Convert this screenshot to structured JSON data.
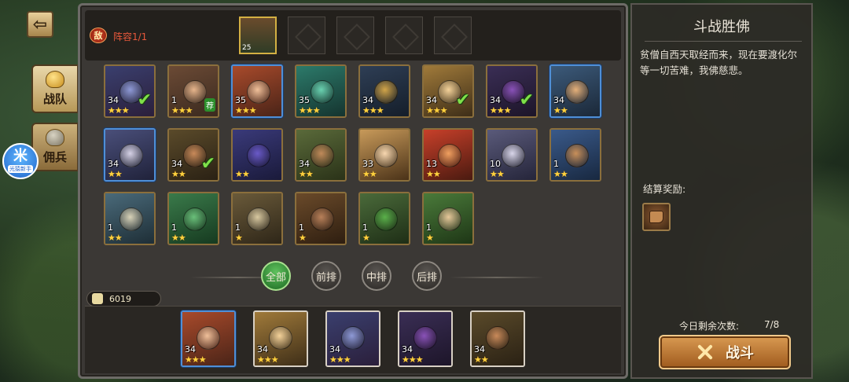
{
  "nav": {
    "back_icon": "back-arrow-icon"
  },
  "side_tabs": [
    {
      "label": "战队",
      "icon": "team-helmet-icon",
      "active": true
    },
    {
      "label": "佣兵",
      "icon": "mercenary-helmet-icon",
      "active": false
    }
  ],
  "beginner_badge": {
    "glyph": "米",
    "caption": "光猿新手"
  },
  "lineup": {
    "enemy_glyph": "敌",
    "label": "阵容1/1",
    "slots": [
      {
        "filled": true,
        "level": "25"
      },
      {
        "filled": false
      },
      {
        "filled": false
      },
      {
        "filled": false
      },
      {
        "filled": false
      }
    ]
  },
  "heroes": [
    {
      "level": "34",
      "stars": "★★★",
      "checked": true,
      "frame": "gold",
      "c1": "#3a3f6e",
      "c2": "#2b1f3b",
      "face": "#8f9ad6"
    },
    {
      "level": "1",
      "stars": "★★★",
      "tag": "荐",
      "frame": "gold",
      "c1": "#6b4a35",
      "c2": "#3b2a1f",
      "face": "#e7b58c"
    },
    {
      "level": "35",
      "stars": "★★★",
      "frame": "blue",
      "c1": "#a84a2b",
      "c2": "#4a2418",
      "face": "#f0c09a"
    },
    {
      "level": "35",
      "stars": "★★★",
      "frame": "gold",
      "c1": "#2c7a6a",
      "c2": "#15342f",
      "face": "#6ad1b0"
    },
    {
      "level": "34",
      "stars": "★★★",
      "frame": "gold",
      "c1": "#2e3e55",
      "c2": "#151e2a",
      "face": "#d1a54a"
    },
    {
      "level": "34",
      "stars": "★★★",
      "checked": true,
      "frame": "gold",
      "c1": "#a07a3a",
      "c2": "#3e2e18",
      "face": "#f4d29a"
    },
    {
      "level": "34",
      "stars": "★★★",
      "checked": true,
      "frame": "gold",
      "c1": "#3a2e55",
      "c2": "#1d1529",
      "face": "#8a52b8"
    },
    {
      "level": "34",
      "stars": "★★",
      "frame": "blue",
      "c1": "#3c5a7a",
      "c2": "#1b2838",
      "face": "#e5b07a"
    },
    {
      "level": "34",
      "stars": "★★",
      "frame": "blue",
      "c1": "#4a4f7a",
      "c2": "#20223a",
      "face": "#d6d2e6"
    },
    {
      "level": "34",
      "stars": "★★",
      "checked": true,
      "frame": "gold",
      "c1": "#5a4a2a",
      "c2": "#2a2114",
      "face": "#c98a5a"
    },
    {
      "level": "",
      "stars": "★★",
      "frame": "gold",
      "c1": "#3a3a7a",
      "c2": "#1a1a3a",
      "face": "#6a5ac8"
    },
    {
      "level": "34",
      "stars": "★★",
      "frame": "gold",
      "c1": "#5a6a3a",
      "c2": "#2a3218",
      "face": "#c08a5a"
    },
    {
      "level": "33",
      "stars": "★★",
      "frame": "gold",
      "c1": "#c89a5a",
      "c2": "#4a3218",
      "face": "#f7d7b0"
    },
    {
      "level": "13",
      "stars": "★★",
      "frame": "gold",
      "c1": "#c8402a",
      "c2": "#4a1a10",
      "face": "#f0a060"
    },
    {
      "level": "10",
      "stars": "★★",
      "frame": "gold",
      "c1": "#5a5a7a",
      "c2": "#25253a",
      "face": "#d9d6ea"
    },
    {
      "level": "1",
      "stars": "★★",
      "frame": "gold",
      "c1": "#3a5a8a",
      "c2": "#182840",
      "face": "#c9905a"
    },
    {
      "level": "1",
      "stars": "★★",
      "frame": "gold",
      "c1": "#4a6a7a",
      "c2": "#1e2e36",
      "face": "#d8d2b8"
    },
    {
      "level": "1",
      "stars": "★★",
      "frame": "gold",
      "c1": "#3a7a4a",
      "c2": "#163a20",
      "face": "#6ac07a"
    },
    {
      "level": "1",
      "stars": "★",
      "frame": "gold",
      "c1": "#6a5a3a",
      "c2": "#2e2618",
      "face": "#d8c8a0"
    },
    {
      "level": "1",
      "stars": "★",
      "frame": "gold",
      "c1": "#6a4a2a",
      "c2": "#2e1e10",
      "face": "#b8805a"
    },
    {
      "level": "1",
      "stars": "★",
      "frame": "gold",
      "c1": "#4a6a3a",
      "c2": "#1e2e16",
      "face": "#5ab04a"
    },
    {
      "level": "1",
      "stars": "★",
      "frame": "gold",
      "c1": "#4a7a3a",
      "c2": "#1e3616",
      "face": "#e7c89a"
    }
  ],
  "filters": [
    {
      "label": "全部",
      "active": true
    },
    {
      "label": "前排",
      "active": false
    },
    {
      "label": "中排",
      "active": false
    },
    {
      "label": "后排",
      "active": false
    }
  ],
  "power": {
    "icon": "fist-icon",
    "value": "6019"
  },
  "selected": [
    {
      "level": "34",
      "stars": "★★★",
      "frame": "blue",
      "c1": "#a84a2b",
      "c2": "#4a2418",
      "face": "#f0c09a"
    },
    {
      "level": "34",
      "stars": "★★★",
      "frame": "white",
      "c1": "#a07a3a",
      "c2": "#3e2e18",
      "face": "#f4d29a"
    },
    {
      "level": "34",
      "stars": "★★★",
      "frame": "white",
      "c1": "#3a3f6e",
      "c2": "#2b1f3b",
      "face": "#8f9ad6"
    },
    {
      "level": "34",
      "stars": "★★★",
      "frame": "white",
      "c1": "#3a2e55",
      "c2": "#1d1529",
      "face": "#8a52b8"
    },
    {
      "level": "34",
      "stars": "★★",
      "frame": "white",
      "c1": "#5a4a2a",
      "c2": "#2a2114",
      "face": "#c98a5a"
    }
  ],
  "stage": {
    "title": "斗战胜佛",
    "description": "贫僧自西天取经而来，现在要渡化尔等一切苦难，我佛慈悲。",
    "reward_label": "结算奖励:",
    "reward_icon": "boots-icon",
    "remaining_label": "今日剩余次数:",
    "remaining_value": "7/8",
    "fight_label": "战斗",
    "fight_icon": "crossed-swords-icon"
  }
}
